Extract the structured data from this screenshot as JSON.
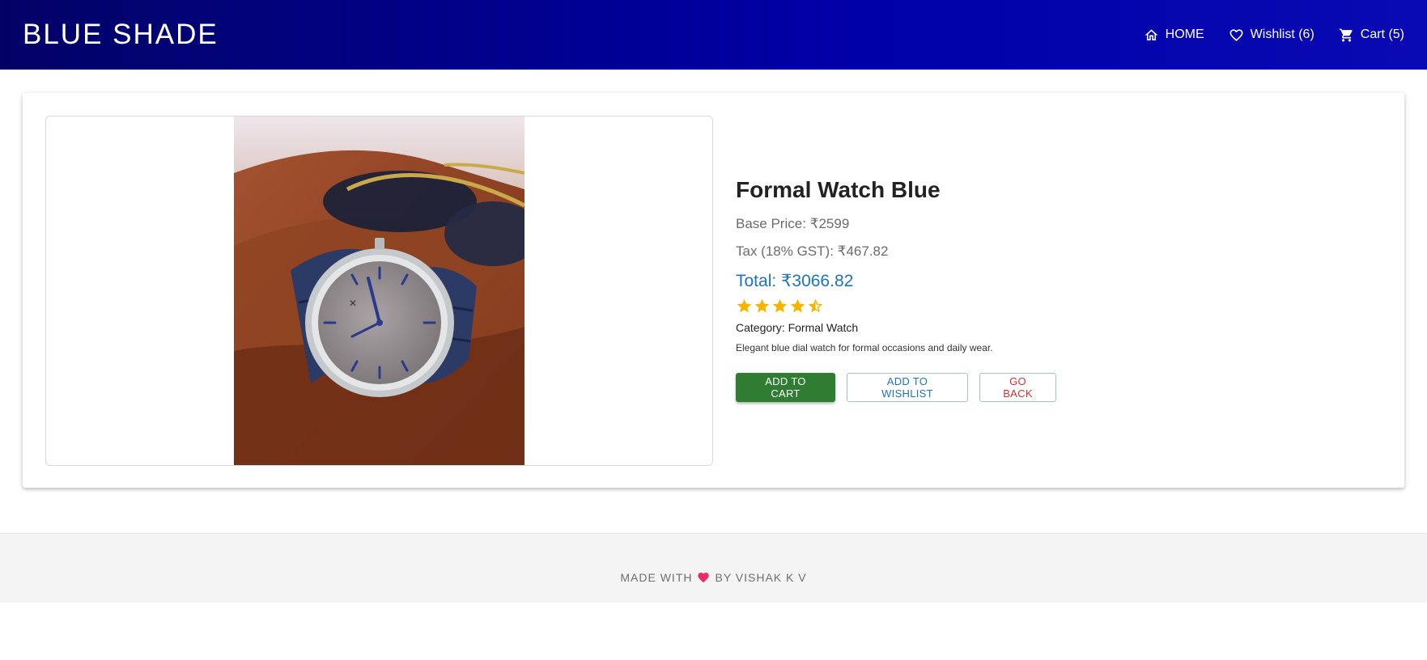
{
  "header": {
    "brand": "BLUE SHADE",
    "nav": {
      "home": "HOME",
      "wishlist": "Wishlist (6)",
      "cart": "Cart (5)"
    }
  },
  "product": {
    "title": "Formal Watch Blue",
    "base_price": "Base Price: ₹2599",
    "tax": "Tax (18% GST): ₹467.82",
    "total": "Total: ₹3066.82",
    "rating": 4.5,
    "category_label": "Category:",
    "category_value": "Formal Watch",
    "description": "Elegant blue dial watch for formal occasions and daily wear.",
    "image_icon": "product-watch-photo"
  },
  "actions": {
    "add_to_cart": "ADD TO CART",
    "add_to_wishlist": "ADD TO WISHLIST",
    "go_back": "GO BACK"
  },
  "footer": {
    "made_with": "MADE WITH",
    "by": "BY VISHAK K V"
  },
  "colors": {
    "appbar_start": "#020266",
    "appbar_end": "#0a0ab4",
    "total_blue": "#1e73be",
    "cart_green": "#2e7d32",
    "back_red": "#d32f2f",
    "star_amber": "#f5b400",
    "heart_pink": "#ee2a6b"
  }
}
